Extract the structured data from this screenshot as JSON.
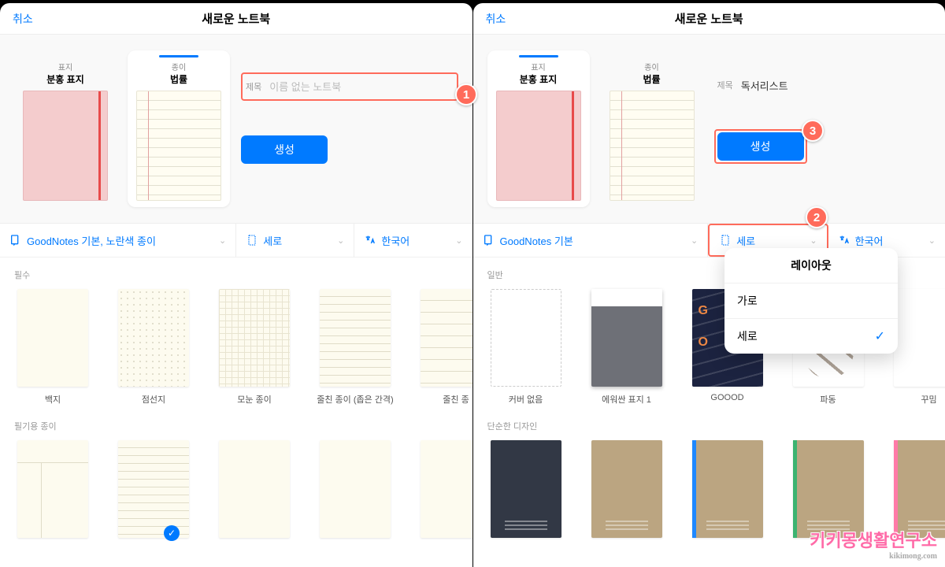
{
  "left": {
    "cancel": "취소",
    "title": "새로운 노트북",
    "cover_label": "표지",
    "cover_name": "분홍 표지",
    "paper_label": "종이",
    "paper_name": "법률",
    "field_label": "제목",
    "field_placeholder": "이름 없는 노트북",
    "create": "생성",
    "tabs": {
      "template": "GoodNotes 기본, 노란색 종이",
      "orientation": "세로",
      "language": "한국어"
    },
    "sec1": "필수",
    "sec2": "필기용 종이",
    "items1": [
      "백지",
      "점선지",
      "모눈 종이",
      "줄친 종이 (좁은 간격)",
      "줄친 종"
    ]
  },
  "right": {
    "cancel": "취소",
    "title": "새로운 노트북",
    "cover_label": "표지",
    "cover_name": "분홍 표지",
    "paper_label": "종이",
    "paper_name": "법률",
    "field_label": "제목",
    "field_value": "독서리스트",
    "create": "생성",
    "tabs": {
      "template": "GoodNotes 기본",
      "orientation": "세로",
      "language": "한국어"
    },
    "sec1": "일반",
    "sec2": "단순한 디자인",
    "items1": [
      "커버 없음",
      "에워싼 표지 1",
      "GOOOD",
      "파동",
      "꾸밈"
    ],
    "popover": {
      "title": "레이아웃",
      "opt1": "가로",
      "opt2": "세로"
    }
  },
  "annotations": {
    "a1": "1",
    "a2": "2",
    "a3": "3"
  },
  "watermark": {
    "main": "키키몽생활연구소",
    "sub": "kikimong.com"
  }
}
